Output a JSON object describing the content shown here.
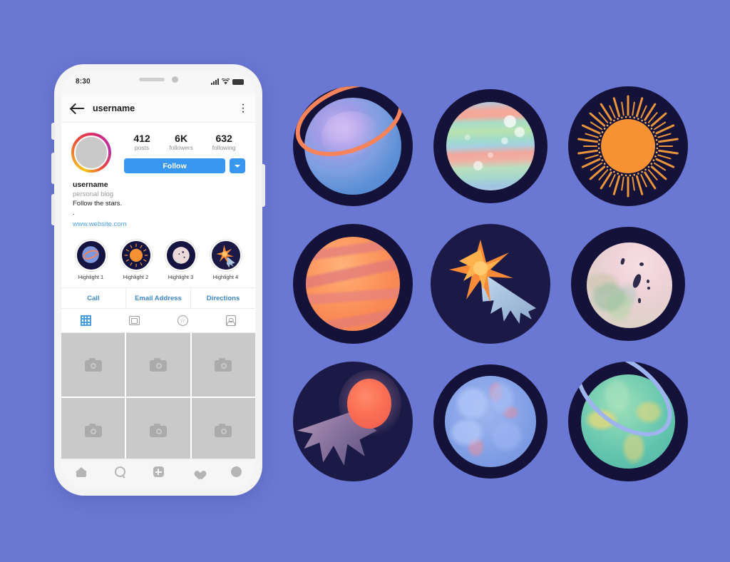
{
  "background_color": "#6a78d4",
  "phone": {
    "status_bar": {
      "time": "8:30",
      "icons": [
        "signal-bars-icon",
        "wifi-icon",
        "battery-icon"
      ]
    },
    "header": {
      "back_icon": "back-arrow-icon",
      "username": "username",
      "menu_icon": "menu-dots-icon"
    },
    "profile": {
      "avatar": "avatar",
      "stats": [
        {
          "number": "412",
          "label": "posts"
        },
        {
          "number": "6K",
          "label": "followers"
        },
        {
          "number": "632",
          "label": "following"
        }
      ],
      "follow_button": "Follow",
      "dropdown_icon": "chevron-down-icon",
      "bio": {
        "name": "username",
        "category": "personal blog",
        "line1": "Follow the stars.",
        "line2": ".",
        "website": "www.website.com"
      }
    },
    "highlights": [
      {
        "label": "Highlight 1",
        "art": "ringed-planet"
      },
      {
        "label": "Highlight 2",
        "art": "sun"
      },
      {
        "label": "Highlight 3",
        "art": "moon"
      },
      {
        "label": "Highlight 4",
        "art": "shooting-star"
      }
    ],
    "contact_buttons": [
      "Call",
      "Email Address",
      "Directions"
    ],
    "content_tabs": [
      {
        "icon": "grid-icon",
        "active": true
      },
      {
        "icon": "tv-icon",
        "active": false
      },
      {
        "icon": "reels-star-icon",
        "active": false
      },
      {
        "icon": "tagged-person-icon",
        "active": false
      }
    ],
    "photo_grid": {
      "placeholder_icon": "camera-icon",
      "cells": 9
    },
    "bottom_nav": [
      "home-icon",
      "search-icon",
      "add-post-icon",
      "heart-icon",
      "profile-avatar-icon"
    ]
  },
  "stickers": [
    {
      "name": "ringed-blue-planet",
      "badge_color": "#141239",
      "accent": "#f7835a"
    },
    {
      "name": "pastel-banded-planet",
      "badge_color": "#141239",
      "accent": "#a9dcc8"
    },
    {
      "name": "sun-with-rays",
      "badge_color": "#141239",
      "accent": "#f79234"
    },
    {
      "name": "jupiter-planet",
      "badge_color": "#141239",
      "accent": "#fd9a62"
    },
    {
      "name": "shooting-star",
      "badge_color": "#1b1a46",
      "accent": "#f98a38"
    },
    {
      "name": "moon",
      "badge_color": "#141239",
      "accent": "#f0d3da"
    },
    {
      "name": "comet",
      "badge_color": "#1b1a46",
      "accent": "#fa6f55"
    },
    {
      "name": "blue-watercolor-planet",
      "badge_color": "#141239",
      "accent": "#8ea9ea"
    },
    {
      "name": "green-ringed-planet",
      "badge_color": "#141239",
      "accent": "#9db4ee"
    }
  ]
}
